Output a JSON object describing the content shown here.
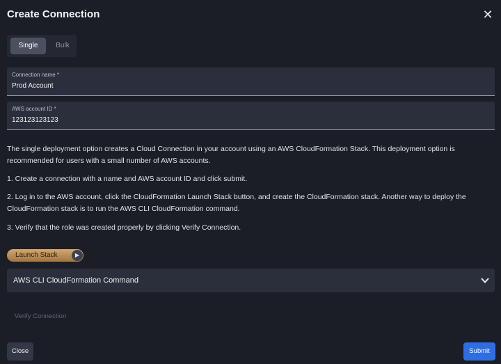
{
  "dialog": {
    "title": "Create Connection",
    "close_icon": "close-icon"
  },
  "tabs": {
    "single": "Single",
    "bulk": "Bulk",
    "selected": "Single"
  },
  "fields": {
    "connection_name": {
      "label": "Connection name *",
      "value": "Prod Account"
    },
    "account_id": {
      "label": "AWS account ID *",
      "value": "123123123123"
    }
  },
  "description": {
    "intro": "The single deployment option creates a Cloud Connection in your account using an AWS CloudFormation Stack. This deployment option is recommended for users with a small number of AWS accounts.",
    "step1": "1. Create a connection with a name and AWS account ID and click submit.",
    "step2": "2. Log in to the AWS account, click the CloudFormation Launch Stack button, and create the CloudFormation stack. Another way to deploy the CloudFormation stack is to run the AWS CLI CloudFormation command.",
    "step3": "3. Verify that the role was created properly by clicking Verify Connection."
  },
  "launch_stack": {
    "label": "Launch Stack",
    "icon": "arrow-right-circle-icon"
  },
  "accordion": {
    "label": "AWS CLI CloudFormation Command",
    "icon": "chevron-down-icon"
  },
  "verify_button": {
    "label": "Verify Connection",
    "disabled": true
  },
  "footer": {
    "close_label": "Close",
    "submit_label": "Submit"
  },
  "colors": {
    "background": "#1b1e26",
    "field": "#2a2f3b",
    "primary": "#2f6de2",
    "launch": "#c49a62"
  }
}
